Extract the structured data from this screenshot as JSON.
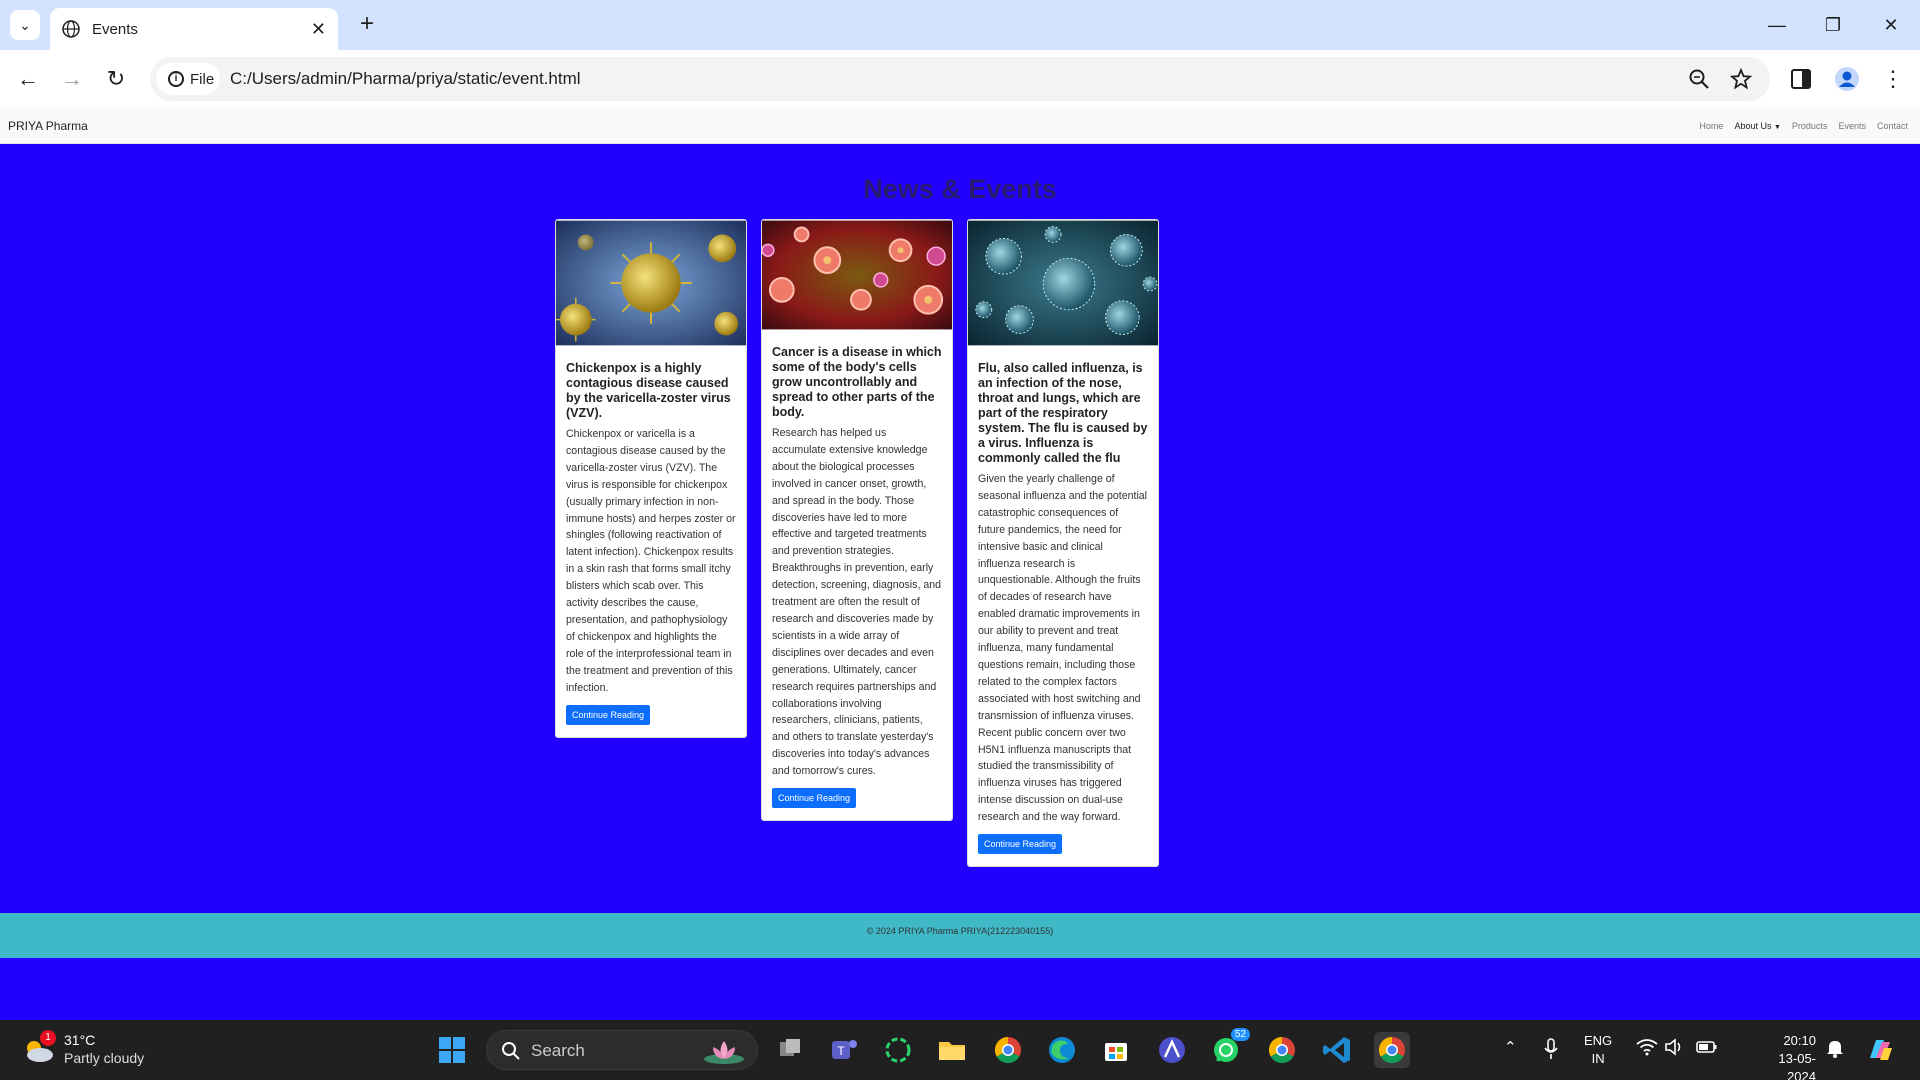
{
  "browser": {
    "tab_title": "Events",
    "address": "C:/Users/admin/Pharma/priya/static/event.html",
    "file_chip": "File"
  },
  "navbar": {
    "brand": "PRIYA Pharma",
    "links": [
      "Home",
      "About Us",
      "Products",
      "Events",
      "Contact"
    ]
  },
  "main": {
    "title": "News & Events",
    "cards": [
      {
        "title": "Chickenpox is a highly contagious disease caused by the varicella-zoster virus (VZV).",
        "text": "Chickenpox or varicella is a contagious disease caused by the varicella-zoster virus (VZV). The virus is responsible for chickenpox (usually primary infection in non-immune hosts) and herpes zoster or shingles (following reactivation of latent infection). Chickenpox results in a skin rash that forms small itchy blisters which scab over. This activity describes the cause, presentation, and pathophysiology of chickenpox and highlights the role of the interprofessional team in the treatment and prevention of this infection.",
        "button": "Continue Reading"
      },
      {
        "title": "Cancer is a disease in which some of the body's cells grow uncontrollably and spread to other parts of the body.",
        "text": "Research has helped us accumulate extensive knowledge about the biological processes involved in cancer onset, growth, and spread in the body. Those discoveries have led to more effective and targeted treatments and prevention strategies. Breakthroughs in prevention, early detection, screening, diagnosis, and treatment are often the result of research and discoveries made by scientists in a wide array of disciplines over decades and even generations. Ultimately, cancer research requires partnerships and collaborations involving researchers, clinicians, patients, and others to translate yesterday's discoveries into today's advances and tomorrow's cures.",
        "button": "Continue Reading"
      },
      {
        "title": "Flu, also called influenza, is an infection of the nose, throat and lungs, which are part of the respiratory system. The flu is caused by a virus. Influenza is commonly called the flu",
        "text": "Given the yearly challenge of seasonal influenza and the potential catastrophic consequences of future pandemics, the need for intensive basic and clinical influenza research is unquestionable. Although the fruits of decades of research have enabled dramatic improvements in our ability to prevent and treat influenza, many fundamental questions remain, including those related to the complex factors associated with host switching and transmission of influenza viruses. Recent public concern over two H5N1 influenza manuscripts that studied the transmissibility of influenza viruses has triggered intense discussion on dual-use research and the way forward.",
        "button": "Continue Reading"
      }
    ]
  },
  "footer": {
    "text": "© 2024 PRIYA Pharma PRIYA(212223040155)"
  },
  "taskbar": {
    "weather_temp": "31°C",
    "weather_cond": "Partly cloudy",
    "weather_badge": "1",
    "search_placeholder": "Search",
    "whatsapp_badge": "52",
    "lang_line1": "ENG",
    "lang_line2": "IN",
    "time": "20:10",
    "date": "13-05-2024"
  },
  "colors": {
    "page_bg": "#2200ff",
    "footer_bg": "#3fb8c8",
    "button_bg": "#0d6efd",
    "tabstrip_bg": "#d3e3fd"
  }
}
